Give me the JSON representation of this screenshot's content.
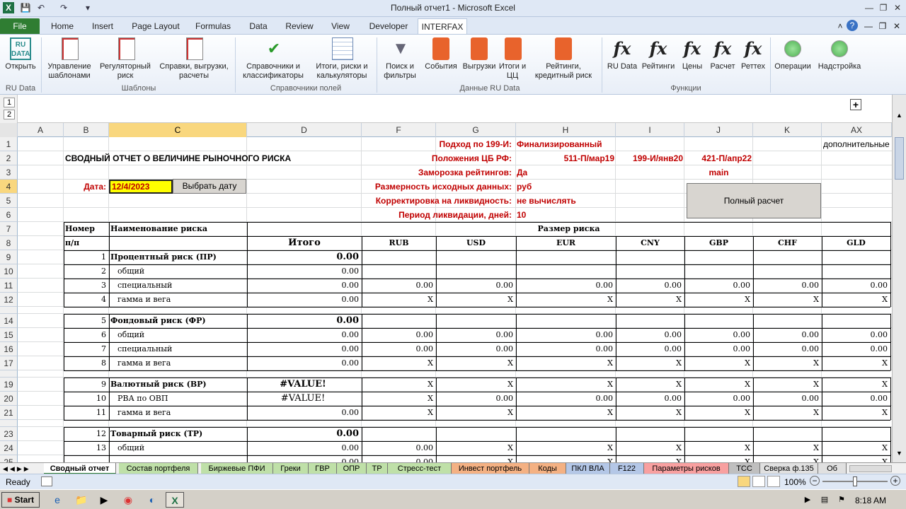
{
  "window": {
    "title": "Полный отчет1 - Microsoft Excel"
  },
  "ribbon_tabs": [
    "File",
    "Home",
    "Insert",
    "Page Layout",
    "Formulas",
    "Data",
    "Review",
    "View",
    "Developer",
    "INTERFAX"
  ],
  "ribbon": {
    "open": "Открыть",
    "ru_data_logo": "RU DATA",
    "ru_data_group": "RU Data",
    "templates": "Управление шаблонами",
    "reg_risk": "Регуляторный риск",
    "refs": "Справки, выгрузки, расчеты",
    "templates_group": "Шаблоны",
    "dicts": "Справочники и классификаторы",
    "totals": "Итоги, риски и калькуляторы",
    "fields_group": "Справочники полей",
    "search": "Поиск и фильтры",
    "events": "События",
    "exports": "Выгрузки",
    "totals_cc": "Итоги и ЦЦ",
    "ratings": "Рейтинги, кредитный риск",
    "data_group": "Данные RU Data",
    "fx_ru": "RU Data",
    "fx_ratings": "Рейтинги",
    "fx_prices": "Цены",
    "fx_calc": "Расчет",
    "fx_repo": "Реттех",
    "func_group": "Функции",
    "ops": "Операции",
    "settings": "Надстройка"
  },
  "outline": {
    "levels": [
      "1",
      "2"
    ],
    "expand": "+"
  },
  "columns": [
    "A",
    "B",
    "C",
    "D",
    "F",
    "G",
    "H",
    "I",
    "J",
    "K",
    "AX"
  ],
  "rows": [
    "1",
    "2",
    "3",
    "4",
    "5",
    "6",
    "7",
    "8",
    "9",
    "10",
    "11",
    "12",
    "14",
    "15",
    "16",
    "17",
    "19",
    "20",
    "21",
    "23",
    "24",
    "25"
  ],
  "header": {
    "title": "СВОДНЫЙ ОТЧЕТ О ВЕЛИЧИНЕ РЫНОЧНОГО РИСКА",
    "date_label": "Дата:",
    "date_value": "12/4/2023",
    "date_button": "Выбрать дату",
    "approach_label": "Подход по 199-И:",
    "approach_value": "Финализированный",
    "cbr_label": "Положения ЦБ РФ:",
    "cbr_v1": "511-П/мар19",
    "cbr_v2": "199-И/янв20",
    "cbr_v3": "421-П/апр22",
    "freeze_label": "Заморозка рейтингов:",
    "freeze_value": "Да",
    "freeze_extra": "main",
    "dim_label": "Размерность исходных данных:",
    "dim_value": "руб",
    "liq_label": "Корректировка на ликвидность:",
    "liq_value": "не вычислять",
    "period_label": "Период ликвидации, дней:",
    "period_value": "10",
    "full_calc": "Полный расчет",
    "extra": "дополнительные"
  },
  "table": {
    "col_num": "Номер",
    "col_num2": "п/п",
    "col_name": "Наименование риска",
    "col_size": "Размер риска",
    "col_total": "Итого",
    "currencies": [
      "RUB",
      "USD",
      "EUR",
      "CNY",
      "GBP",
      "CHF",
      "GLD"
    ],
    "rows": [
      {
        "n": "1",
        "name": "Процентный риск (ПР)",
        "total": "0.00",
        "vals": [
          "",
          "",
          "",
          "",
          "",
          "",
          ""
        ],
        "bold": true
      },
      {
        "n": "2",
        "name": "общий",
        "total": "0.00",
        "vals": [
          "",
          "",
          "",
          "",
          "",
          "",
          ""
        ]
      },
      {
        "n": "3",
        "name": "специальный",
        "total": "0.00",
        "vals": [
          "0.00",
          "0.00",
          "0.00",
          "0.00",
          "0.00",
          "0.00",
          "0.00"
        ]
      },
      {
        "n": "4",
        "name": "гамма и вега",
        "total": "0.00",
        "vals": [
          "X",
          "X",
          "X",
          "X",
          "X",
          "X",
          "X"
        ]
      },
      {
        "n": "5",
        "name": "Фондовый риск (ФР)",
        "total": "0.00",
        "vals": [
          "",
          "",
          "",
          "",
          "",
          "",
          ""
        ],
        "bold": true
      },
      {
        "n": "6",
        "name": "общий",
        "total": "0.00",
        "vals": [
          "0.00",
          "0.00",
          "0.00",
          "0.00",
          "0.00",
          "0.00",
          "0.00"
        ]
      },
      {
        "n": "7",
        "name": "специальный",
        "total": "0.00",
        "vals": [
          "0.00",
          "0.00",
          "0.00",
          "0.00",
          "0.00",
          "0.00",
          "0.00"
        ]
      },
      {
        "n": "8",
        "name": "гамма и вега",
        "total": "0.00",
        "vals": [
          "X",
          "X",
          "X",
          "X",
          "X",
          "X",
          "X"
        ]
      },
      {
        "n": "9",
        "name": "Валютный риск (ВР)",
        "total": "#VALUE!",
        "vals": [
          "X",
          "X",
          "X",
          "X",
          "X",
          "X",
          "X"
        ],
        "bold": true
      },
      {
        "n": "10",
        "name": "РВА по ОВП",
        "total": "#VALUE!",
        "vals": [
          "X",
          "0.00",
          "0.00",
          "0.00",
          "0.00",
          "0.00",
          "0.00"
        ]
      },
      {
        "n": "11",
        "name": "гамма и вега",
        "total": "0.00",
        "vals": [
          "X",
          "X",
          "X",
          "X",
          "X",
          "X",
          "X"
        ]
      },
      {
        "n": "12",
        "name": "Товарный риск (ТР)",
        "total": "0.00",
        "vals": [
          "",
          "",
          "",
          "",
          "",
          "",
          ""
        ],
        "bold": true
      },
      {
        "n": "13",
        "name": "общий",
        "total": "0.00",
        "vals": [
          "0.00",
          "X",
          "X",
          "X",
          "X",
          "X",
          "X"
        ]
      },
      {
        "n": "",
        "name": "",
        "total": "0.00",
        "vals": [
          "0.00",
          "X",
          "X",
          "X",
          "X",
          "X",
          "X"
        ]
      }
    ]
  },
  "sheets": [
    "Сводный отчет",
    "Состав портфеля",
    "Биржевые ПФИ",
    "Греки",
    "ГВР",
    "ОПР",
    "ТР",
    "Стресс-тест",
    "Инвест портфель",
    "Коды",
    "ПКЛ ВЛА",
    "F122",
    "Параметры рисков",
    "ТСС",
    "Сверка ф.135",
    "Об"
  ],
  "status": {
    "ready": "Ready",
    "zoom": "100%"
  },
  "taskbar": {
    "start": "Start",
    "time": "8:18 AM"
  },
  "colors": {
    "excel_green": "#2f7d32",
    "red_text": "#c00000",
    "selected_header": "#f9d77e",
    "date_fill": "#ffff00"
  }
}
